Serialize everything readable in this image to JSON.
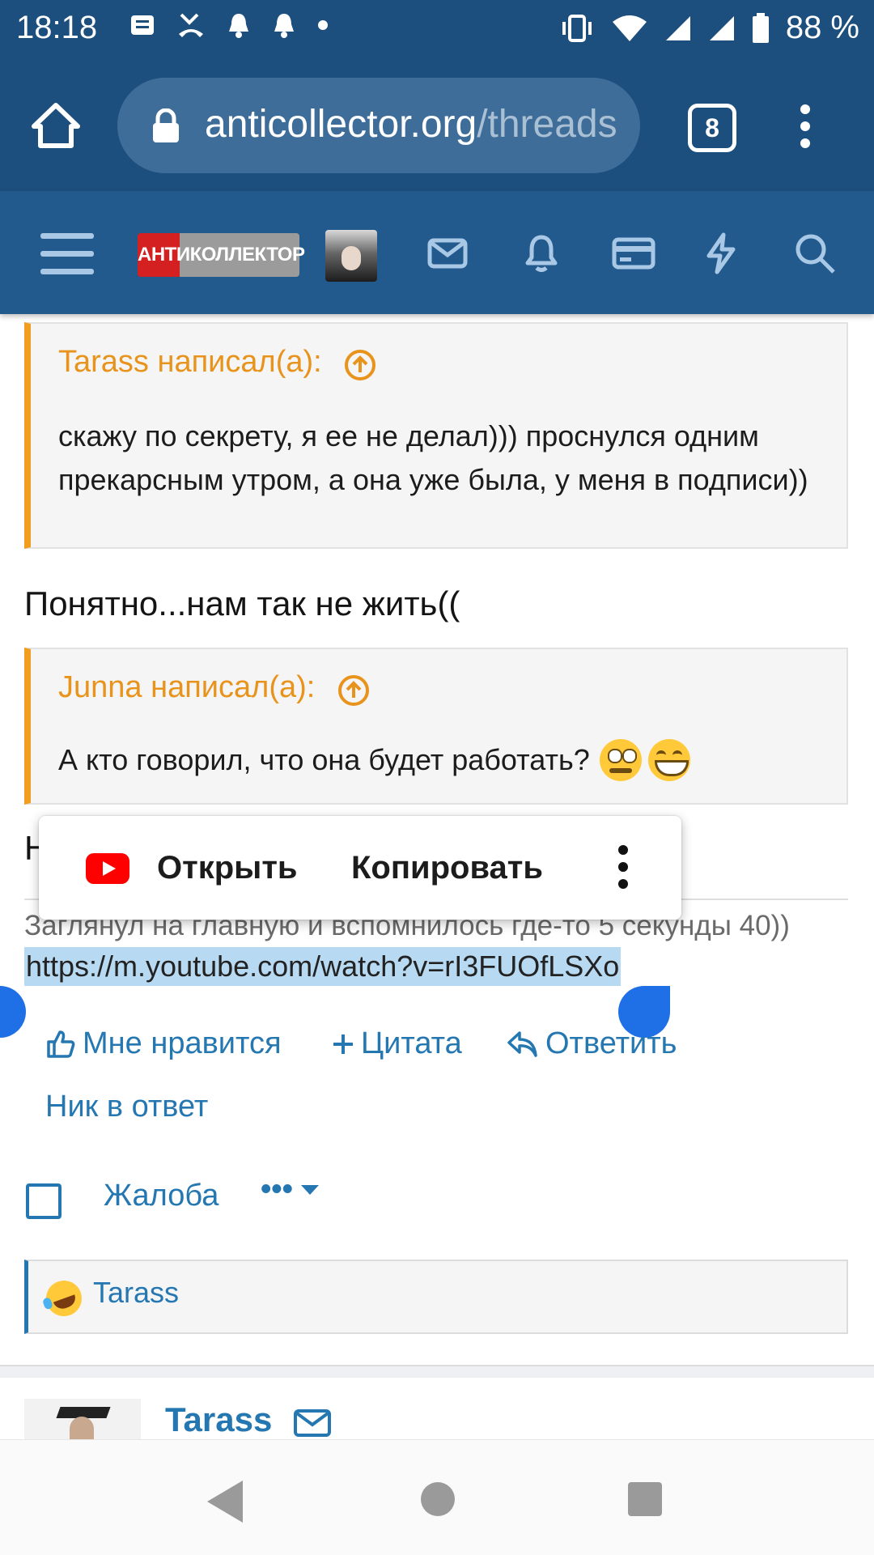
{
  "status_bar": {
    "time": "18:18",
    "battery": "88 %",
    "icons": [
      "notification-icon",
      "missed-call-icon",
      "bell-icon",
      "bell-icon",
      "dot-icon",
      "vibrate-icon",
      "wifi-icon",
      "signal-icon",
      "signal-icon",
      "battery-icon"
    ]
  },
  "browser": {
    "url_domain": "anticollector.org",
    "url_path": "/threads",
    "tab_count": "8"
  },
  "site_header": {
    "logo_text": "АНТИКОЛЛЕКТОР",
    "icons": [
      "menu-icon",
      "mail-icon",
      "bell-icon",
      "card-icon",
      "lightning-icon",
      "search-icon"
    ]
  },
  "content": {
    "quote1": {
      "author": "Tarass написал(а):",
      "text": "скажу по секрету, я ее не делал))) проснулся одним прекарсным утром, а она уже была, у меня в подписи))"
    },
    "reply1": "Понятно...нам так не жить((",
    "quote2": {
      "author": "Junna написал(а):",
      "text": "А кто говорил, что она будет работать?"
    },
    "reply2_partial": "Н",
    "signature": "Заглянул на главную и вспомнилось где-то 5 секунды 40))",
    "link": "https://m.youtube.com/watch?v=rI3FUOfLSXo",
    "popup": {
      "open_label": "Открыть",
      "copy_label": "Копировать"
    },
    "actions": {
      "like": "Мне нравится",
      "quote": "Цитата",
      "reply": "Ответить",
      "nick": "Ник в ответ",
      "report": "Жалоба",
      "more": "•••"
    },
    "reactions": {
      "user": "Tarass"
    },
    "next_post": {
      "author": "Tarass"
    }
  },
  "colors": {
    "header_dark": "#1d4f7e",
    "header": "#235a8d",
    "quote_accent": "#f29d1e",
    "link_blue": "#2577b1",
    "selection": "#b7d9f2"
  }
}
